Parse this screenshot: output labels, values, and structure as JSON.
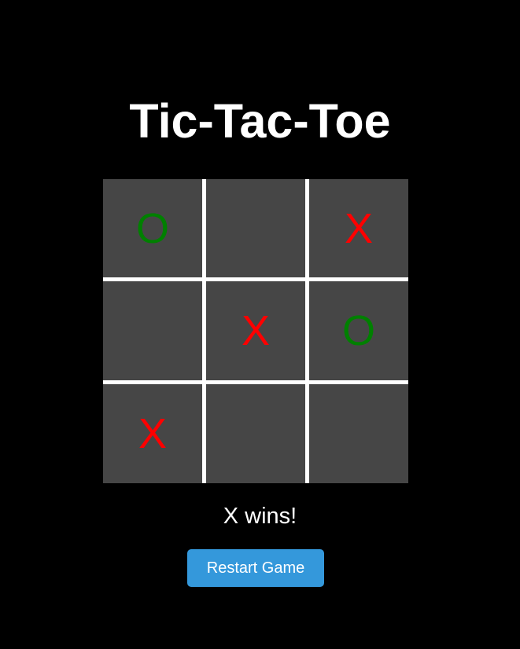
{
  "title": "Tic-Tac-Toe",
  "board": {
    "cells": [
      "O",
      "",
      "X",
      "",
      "X",
      "O",
      "X",
      "",
      ""
    ]
  },
  "status": "X wins!",
  "restart_label": "Restart Game",
  "colors": {
    "background": "#000000",
    "cell": "#464646",
    "grid_lines": "#ffffff",
    "x_mark": "#ff0000",
    "o_mark": "#008000",
    "button": "#3498db"
  }
}
